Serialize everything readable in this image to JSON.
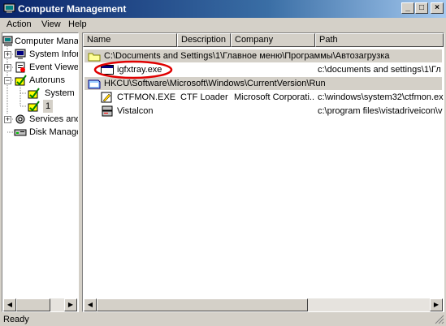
{
  "window": {
    "title": "Computer Management",
    "minimize": "_",
    "maximize": "□",
    "close": "×"
  },
  "menu": [
    "Action",
    "View",
    "Help"
  ],
  "tree": {
    "items": [
      {
        "label": "Computer Manag"
      },
      {
        "label": "System Infor"
      },
      {
        "label": "Event Viewe"
      },
      {
        "label": "Autoruns"
      },
      {
        "label": "System"
      },
      {
        "label": "1"
      },
      {
        "label": "Services and"
      },
      {
        "label": "Disk Manage"
      }
    ]
  },
  "list": {
    "columns": [
      "Name",
      "Description",
      "Company",
      "Path"
    ],
    "groups": [
      {
        "header": "C:\\Documents and Settings\\1\\Главное меню\\Программы\\Автозагрузка",
        "rows": [
          {
            "name": "igfxtray.exe",
            "description": "",
            "company": "",
            "path": "c:\\documents and settings\\1\\Гл"
          }
        ]
      },
      {
        "header": "HKCU\\Software\\Microsoft\\Windows\\CurrentVersion\\Run",
        "rows": [
          {
            "name": "CTFMON.EXE",
            "description": "CTF Loader",
            "company": "Microsoft Corporati...",
            "path": "c:\\windows\\system32\\ctfmon.ex"
          },
          {
            "name": "Vistalcon",
            "description": "",
            "company": "",
            "path": "c:\\program files\\vistadriveicon\\v"
          }
        ]
      }
    ]
  },
  "status": {
    "text": "Ready"
  },
  "colors": {
    "title_start": "#0a246a",
    "title_end": "#a6caf0",
    "highlight_circle": "#e00000"
  }
}
